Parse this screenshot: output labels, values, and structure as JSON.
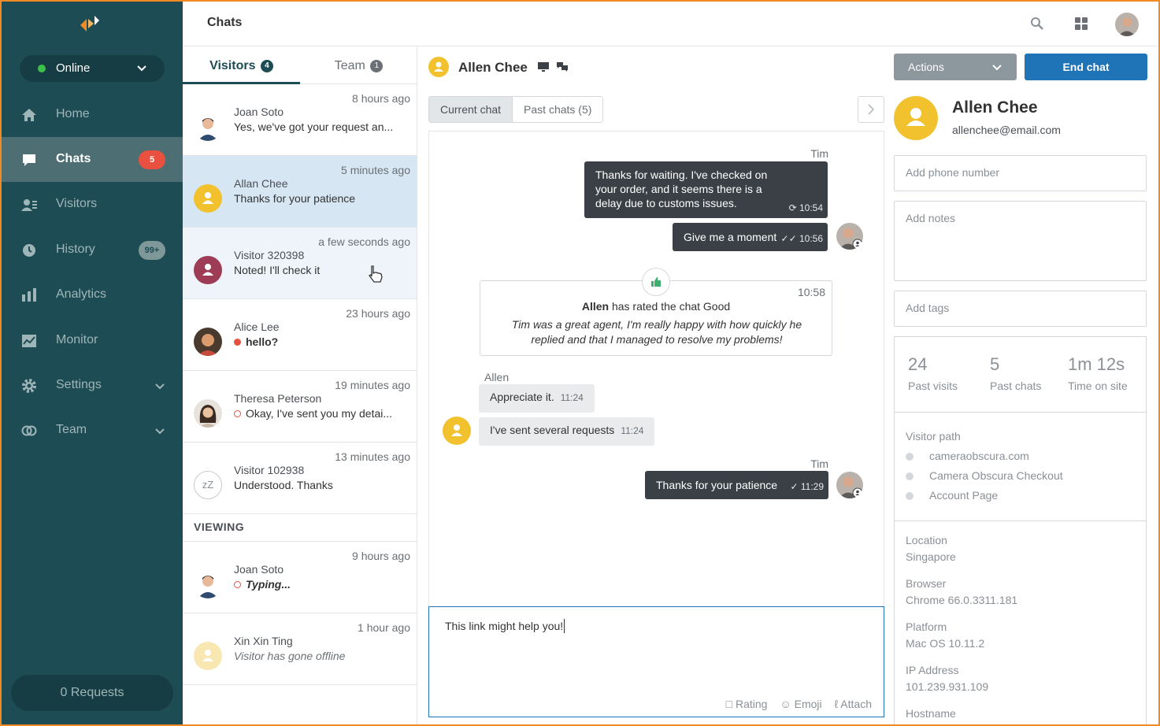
{
  "app": {
    "page_title": "Chats"
  },
  "sidebar": {
    "status": "Online",
    "items": [
      {
        "label": "Home"
      },
      {
        "label": "Chats",
        "badge": "5"
      },
      {
        "label": "Visitors"
      },
      {
        "label": "History",
        "badge": "99+"
      },
      {
        "label": "Analytics"
      },
      {
        "label": "Monitor"
      },
      {
        "label": "Settings"
      },
      {
        "label": "Team"
      }
    ],
    "requests": "0 Requests"
  },
  "list": {
    "tabs": [
      {
        "label": "Visitors",
        "count": "4"
      },
      {
        "label": "Team",
        "count": "1"
      }
    ],
    "chats": [
      {
        "name": "Joan Soto",
        "time": "8 hours ago",
        "message": "Yes, we've got your request an..."
      },
      {
        "name": "Allan Chee",
        "time": "5 minutes ago",
        "message": "Thanks for your patience"
      },
      {
        "name": "Visitor 320398",
        "time": "a few seconds ago",
        "message": "Noted! I'll check it"
      },
      {
        "name": "Alice Lee",
        "time": "23 hours ago",
        "message": "hello?"
      },
      {
        "name": "Theresa Peterson",
        "time": "19 minutes ago",
        "message": "Okay, I've sent you my detai..."
      },
      {
        "name": "Visitor 102938",
        "time": "13 minutes ago",
        "message": "Understood. Thanks"
      }
    ],
    "viewing_header": "VIEWING",
    "viewing": [
      {
        "name": "Joan Soto",
        "time": "9 hours ago",
        "message": "Typing..."
      },
      {
        "name": "Xin Xin Ting",
        "time": "1 hour ago",
        "message": "Visitor has gone offline"
      }
    ],
    "idle_icon_text": "zZ"
  },
  "chat": {
    "visitor_name": "Allen Chee",
    "segments": [
      "Current chat",
      "Past chats (5)"
    ],
    "messages": {
      "m1_author": "Tim",
      "m1_text": "Thanks for waiting. I've checked on your order, and it seems there is a delay due to customs issues.",
      "m1_time": "10:54",
      "m2_text": "Give me a moment",
      "m2_time": "10:56",
      "rating_time": "10:58",
      "rating_name": "Allen",
      "rating_text": " has rated the chat Good",
      "rating_comment": "Tim was a great agent, I'm really happy with how quickly he replied and that I managed to resolve my problems!",
      "m3_author": "Allen",
      "m3_text": "Appreciate it.",
      "m3_time": "11:24",
      "m4_text": "I've sent several requests",
      "m4_time": "11:24",
      "m5_author": "Tim",
      "m5_text": "Thanks for your patience",
      "m5_time": "11:29"
    },
    "compose_text": "This link might help you!",
    "tools": {
      "rating": "Rating",
      "emoji": "Emoji",
      "attach": "Attach"
    }
  },
  "panel": {
    "actions_label": "Actions",
    "end_label": "End chat",
    "name": "Allen Chee",
    "email": "allenchee@email.com",
    "phone_placeholder": "Add phone number",
    "notes_placeholder": "Add notes",
    "tags_placeholder": "Add tags",
    "stats": [
      {
        "value": "24",
        "label": "Past visits"
      },
      {
        "value": "5",
        "label": "Past chats"
      },
      {
        "value": "1m 12s",
        "label": "Time on site"
      }
    ],
    "path_header": "Visitor path",
    "path": [
      "cameraobscura.com",
      "Camera Obscura Checkout",
      "Account Page"
    ],
    "info": [
      {
        "key": "Location",
        "value": "Singapore"
      },
      {
        "key": "Browser",
        "value": "Chrome 66.0.3311.181"
      },
      {
        "key": "Platform",
        "value": "Mac OS 10.11.2"
      },
      {
        "key": "IP Address",
        "value": "101.239.931.109"
      },
      {
        "key": "Hostname",
        "value": ""
      }
    ]
  },
  "colors": {
    "sidebar": "#1e4c54",
    "accent": "#1f73b7",
    "brand": "#f08a24",
    "online": "#3dc14b",
    "badge": "#e9503f",
    "avatar_yellow": "#f2c12e"
  }
}
